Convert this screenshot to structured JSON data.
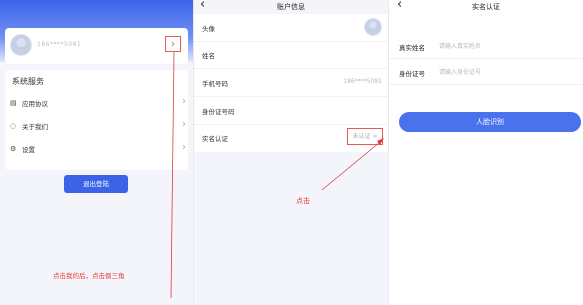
{
  "panel_mine": {
    "phone_masked": "186****5081",
    "section_title": "系统服务",
    "menu": [
      {
        "icon": "document-icon",
        "label": "应用协议"
      },
      {
        "icon": "chat-icon",
        "label": "关于我们"
      },
      {
        "icon": "gear-icon",
        "label": "设置"
      }
    ],
    "logout_label": "退出登陆",
    "annotation": "点击我的后，点击倒三角",
    "chevron": "›"
  },
  "panel_account": {
    "back": "‹",
    "title": "账户信息",
    "rows": [
      {
        "label": "头像",
        "value": ""
      },
      {
        "label": "姓名",
        "value": ""
      },
      {
        "label": "手机号码",
        "value": "186****5081"
      },
      {
        "label": "身份证号码",
        "value": ""
      },
      {
        "label": "实名认证",
        "value": "未认证 >"
      }
    ],
    "annotation": "点击"
  },
  "panel_verify": {
    "back": "‹",
    "title": "实名认证",
    "fields": [
      {
        "label": "真实姓名",
        "placeholder": "请输入真实姓名"
      },
      {
        "label": "身份证号",
        "placeholder": "请输入身份证号"
      }
    ],
    "button_label": "人脸识别"
  },
  "colors": {
    "primary": "#3a63e8",
    "annotation_red": "#e23a3a",
    "page_bg": "#f3f5fa"
  }
}
